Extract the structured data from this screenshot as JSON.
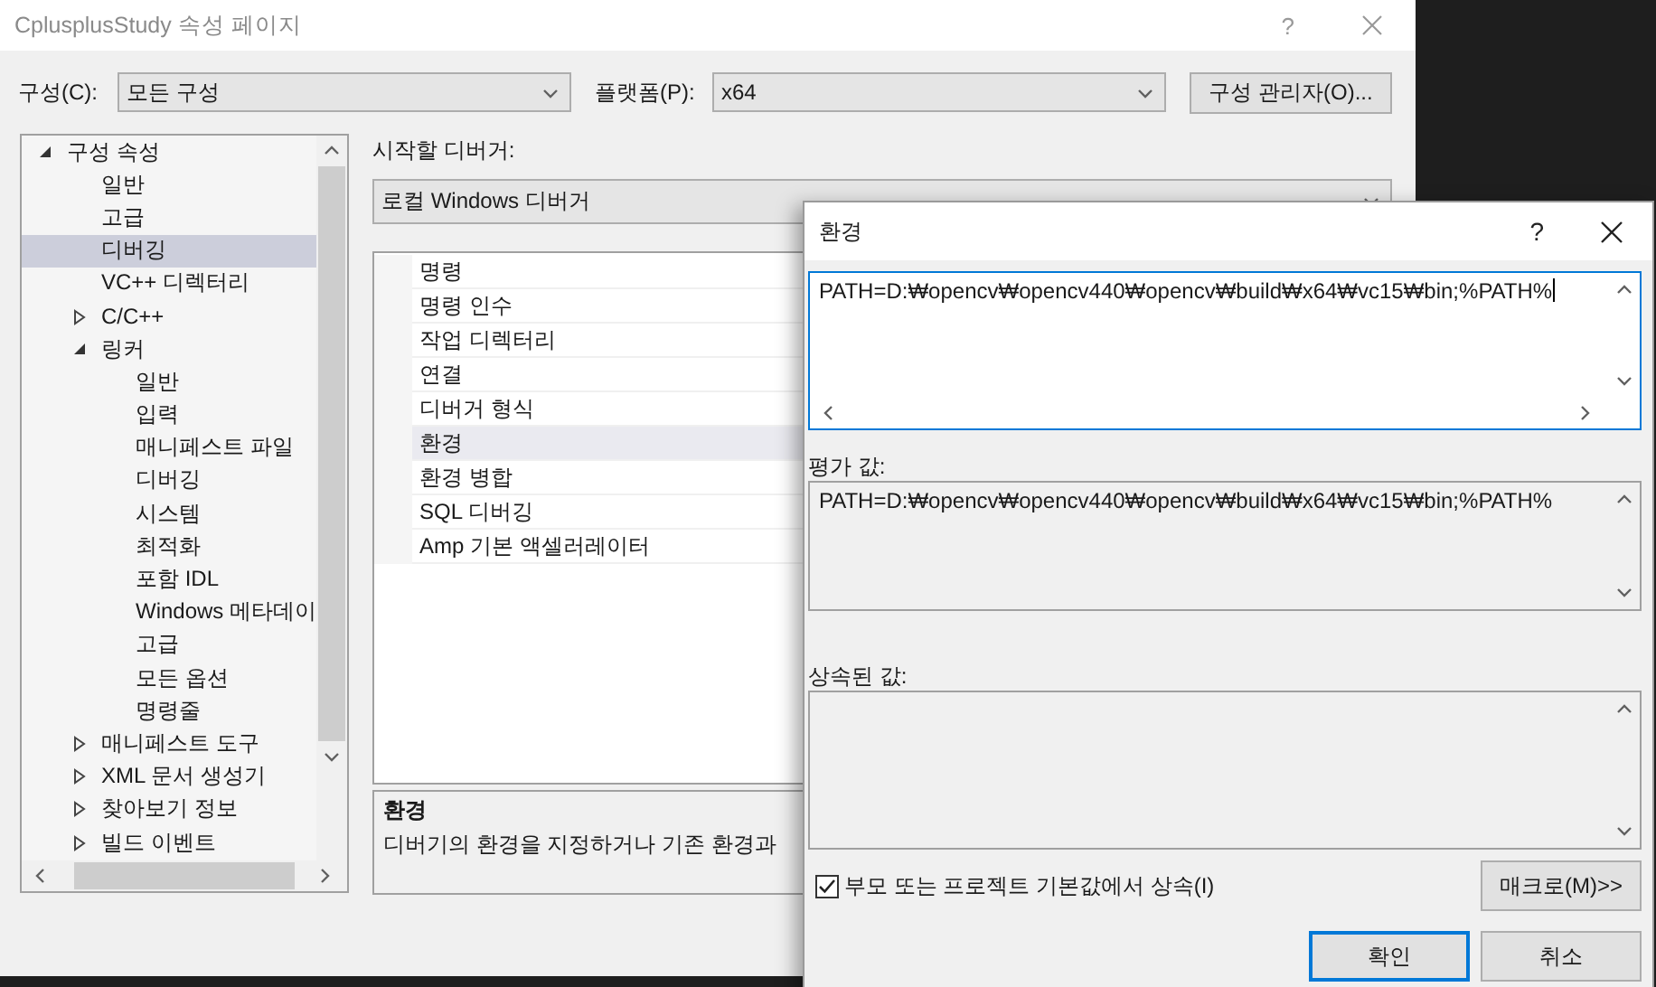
{
  "window": {
    "title": "CplusplusStudy 속성 페이지",
    "help": "?"
  },
  "config": {
    "label": "구성(C):",
    "value": "모든 구성"
  },
  "platform": {
    "label": "플랫폼(P):",
    "value": "x64"
  },
  "config_manager_button": "구성 관리자(O)...",
  "tree": [
    {
      "label": "구성 속성",
      "kind": "group",
      "expanded": true,
      "selected": false,
      "children": [
        {
          "label": "일반",
          "kind": "leaf",
          "selected": false
        },
        {
          "label": "고급",
          "kind": "leaf",
          "selected": false
        },
        {
          "label": "디버깅",
          "kind": "leaf",
          "selected": true
        },
        {
          "label": "VC++ 디렉터리",
          "kind": "leaf",
          "selected": false
        },
        {
          "label": "C/C++",
          "kind": "group",
          "expanded": false,
          "selected": false
        },
        {
          "label": "링커",
          "kind": "group",
          "expanded": true,
          "selected": false,
          "children": [
            {
              "label": "일반",
              "kind": "leaf",
              "selected": false
            },
            {
              "label": "입력",
              "kind": "leaf",
              "selected": false
            },
            {
              "label": "매니페스트 파일",
              "kind": "leaf",
              "selected": false
            },
            {
              "label": "디버깅",
              "kind": "leaf",
              "selected": false
            },
            {
              "label": "시스템",
              "kind": "leaf",
              "selected": false
            },
            {
              "label": "최적화",
              "kind": "leaf",
              "selected": false
            },
            {
              "label": "포함 IDL",
              "kind": "leaf",
              "selected": false
            },
            {
              "label": "Windows 메타데이",
              "kind": "leaf",
              "selected": false
            },
            {
              "label": "고급",
              "kind": "leaf",
              "selected": false
            },
            {
              "label": "모든 옵션",
              "kind": "leaf",
              "selected": false
            },
            {
              "label": "명령줄",
              "kind": "leaf",
              "selected": false
            }
          ]
        },
        {
          "label": "매니페스트 도구",
          "kind": "group",
          "expanded": false,
          "selected": false
        },
        {
          "label": "XML 문서 생성기",
          "kind": "group",
          "expanded": false,
          "selected": false
        },
        {
          "label": "찾아보기 정보",
          "kind": "group",
          "expanded": false,
          "selected": false
        },
        {
          "label": "빌드 이벤트",
          "kind": "group",
          "expanded": false,
          "selected": false
        }
      ]
    }
  ],
  "debugger": {
    "label": "시작할 디버거:",
    "value": "로컬 Windows 디버거"
  },
  "properties": [
    {
      "name": "명령",
      "selected": false
    },
    {
      "name": "명령 인수",
      "selected": false
    },
    {
      "name": "작업 디렉터리",
      "selected": false
    },
    {
      "name": "연결",
      "selected": false
    },
    {
      "name": "디버거 형식",
      "selected": false
    },
    {
      "name": "환경",
      "selected": true
    },
    {
      "name": "환경 병합",
      "selected": false
    },
    {
      "name": "SQL 디버깅",
      "selected": false
    },
    {
      "name": "Amp 기본 액셀러레이터",
      "selected": false
    }
  ],
  "description": {
    "title": "환경",
    "text": "디버기의 환경을 지정하거나 기존 환경과"
  },
  "dialog": {
    "title": "환경",
    "help": "?",
    "value": "PATH=D:₩opencv₩opencv440₩opencv₩build₩x64₩vc15₩bin;%PATH%",
    "evaluated_label": "평가 값:",
    "evaluated": "PATH=D:₩opencv₩opencv440₩opencv₩build₩x64₩vc15₩bin;%PATH%",
    "inherited_label": "상속된 값:",
    "inherit": {
      "label": "부모 또는 프로젝트 기본값에서 상속(I)",
      "checked": true
    },
    "macro_button": "매크로(M)>>",
    "ok_button": "확인",
    "cancel_button": "취소"
  }
}
